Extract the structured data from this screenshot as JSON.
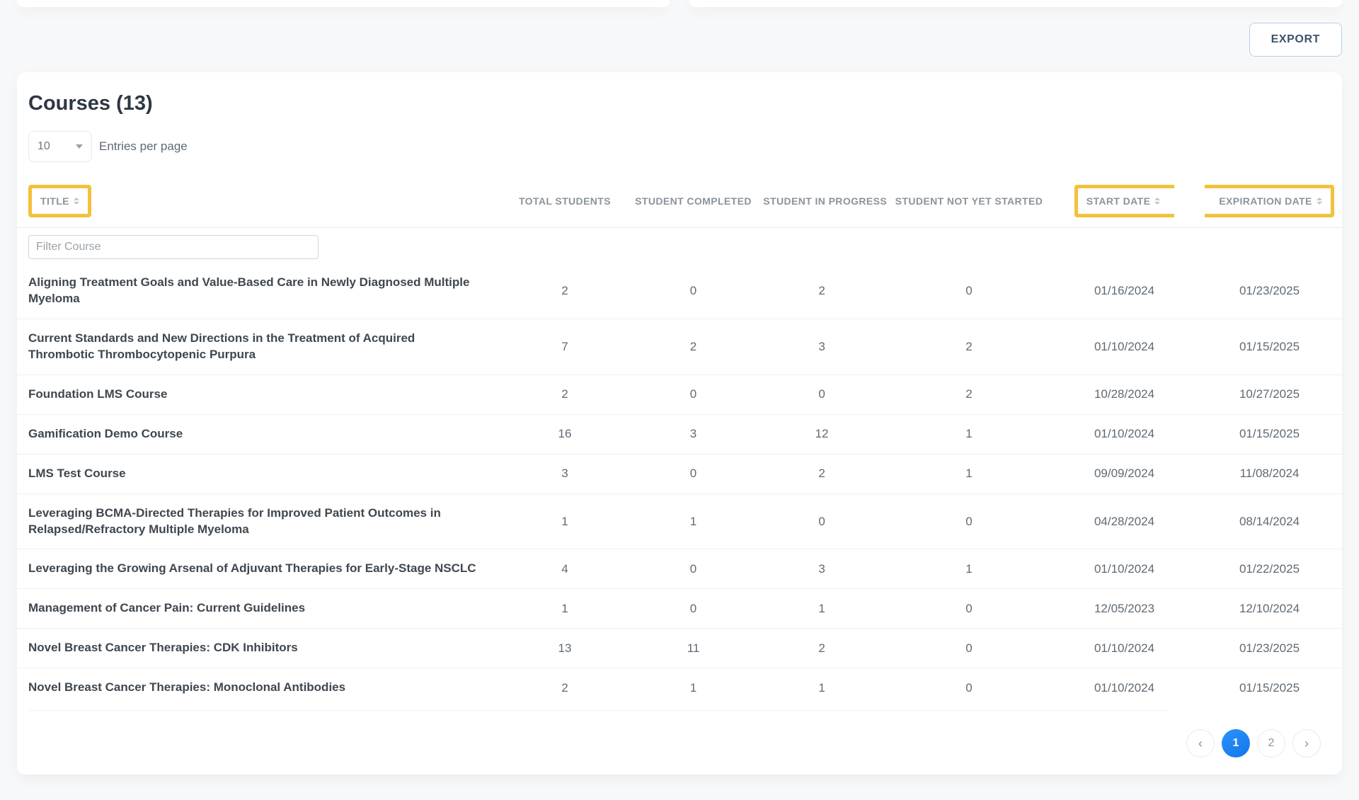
{
  "header": {
    "export_label": "EXPORT",
    "page_title": "Courses (13)",
    "entries_value": "10",
    "entries_label": "Entries per page"
  },
  "columns": {
    "title": "TITLE",
    "total_students": "TOTAL STUDENTS",
    "student_completed": "STUDENT COMPLETED",
    "student_in_progress": "STUDENT IN PROGRESS",
    "student_not_yet_started": "STUDENT NOT YET STARTED",
    "start_date": "START DATE",
    "expiration_date": "EXPIRATION DATE"
  },
  "filter": {
    "placeholder": "Filter Course"
  },
  "rows": [
    {
      "title": "Aligning Treatment Goals and Value-Based Care in Newly Diagnosed Multiple Myeloma",
      "total": "2",
      "completed": "0",
      "in_progress": "2",
      "not_started": "0",
      "start": "01/16/2024",
      "exp": "01/23/2025"
    },
    {
      "title": "Current Standards and New Directions in the Treatment of Acquired Thrombotic Thrombocytopenic Purpura",
      "total": "7",
      "completed": "2",
      "in_progress": "3",
      "not_started": "2",
      "start": "01/10/2024",
      "exp": "01/15/2025"
    },
    {
      "title": "Foundation LMS Course",
      "total": "2",
      "completed": "0",
      "in_progress": "0",
      "not_started": "2",
      "start": "10/28/2024",
      "exp": "10/27/2025"
    },
    {
      "title": "Gamification Demo Course",
      "total": "16",
      "completed": "3",
      "in_progress": "12",
      "not_started": "1",
      "start": "01/10/2024",
      "exp": "01/15/2025"
    },
    {
      "title": "LMS Test Course",
      "total": "3",
      "completed": "0",
      "in_progress": "2",
      "not_started": "1",
      "start": "09/09/2024",
      "exp": "11/08/2024"
    },
    {
      "title": "Leveraging BCMA-Directed Therapies for Improved Patient Outcomes in Relapsed/Refractory Multiple Myeloma",
      "total": "1",
      "completed": "1",
      "in_progress": "0",
      "not_started": "0",
      "start": "04/28/2024",
      "exp": "08/14/2024"
    },
    {
      "title": "Leveraging the Growing Arsenal of Adjuvant Therapies for Early-Stage NSCLC",
      "total": "4",
      "completed": "0",
      "in_progress": "3",
      "not_started": "1",
      "start": "01/10/2024",
      "exp": "01/22/2025"
    },
    {
      "title": "Management of Cancer Pain: Current Guidelines",
      "total": "1",
      "completed": "0",
      "in_progress": "1",
      "not_started": "0",
      "start": "12/05/2023",
      "exp": "12/10/2024"
    },
    {
      "title": "Novel Breast Cancer Therapies: CDK Inhibitors",
      "total": "13",
      "completed": "11",
      "in_progress": "2",
      "not_started": "0",
      "start": "01/10/2024",
      "exp": "01/23/2025"
    },
    {
      "title": "Novel Breast Cancer Therapies: Monoclonal Antibodies",
      "total": "2",
      "completed": "1",
      "in_progress": "1",
      "not_started": "0",
      "start": "01/10/2024",
      "exp": "01/15/2025"
    }
  ],
  "pagination": {
    "prev": "‹",
    "pages": [
      "1",
      "2"
    ],
    "current": "1",
    "next": "›"
  }
}
